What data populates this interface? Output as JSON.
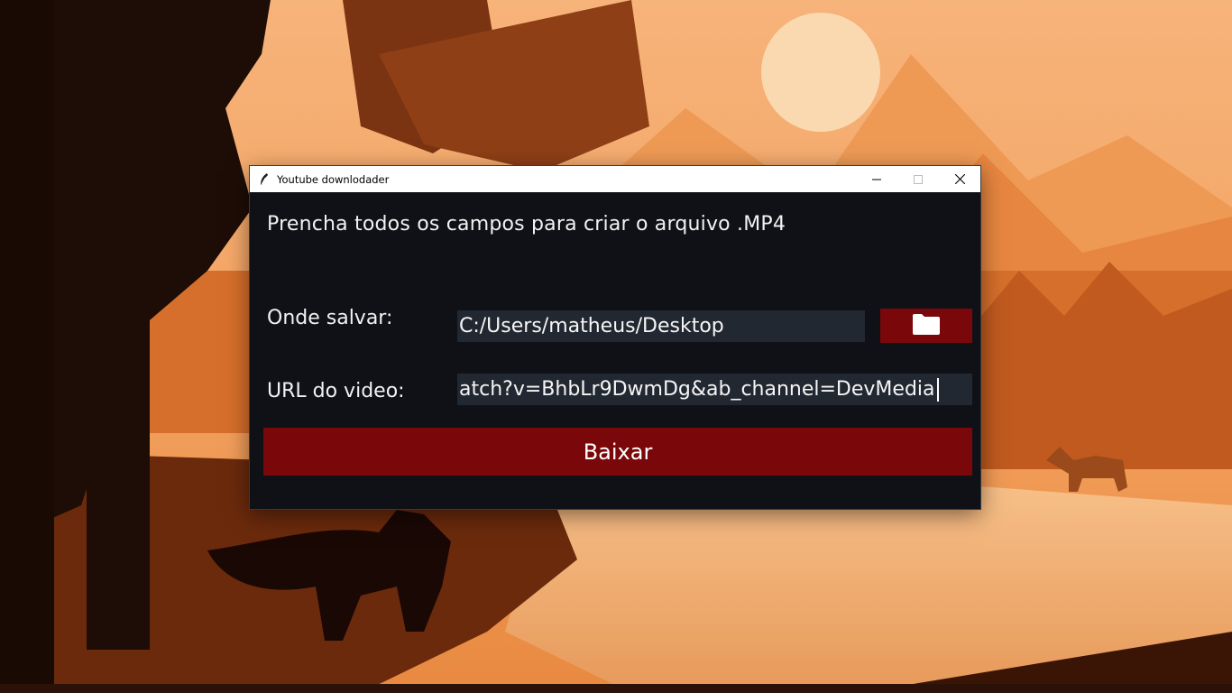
{
  "window": {
    "title": "Youtube downlodader",
    "controls": {
      "minimize_icon": "minimize-icon",
      "maximize_icon": "maximize-icon",
      "close_icon": "close-icon"
    }
  },
  "form": {
    "heading": "Prencha todos os  campos para criar o arquivo .MP4",
    "save_label": "Onde salvar:",
    "save_path_value": "C:/Users/matheus/Desktop",
    "browse_icon": "folder-icon",
    "url_label": "URL do video:",
    "url_value": "atch?v=BhbLr9DwmDg&ab_channel=DevMedia",
    "download_button": "Baixar"
  },
  "colors": {
    "window_bg": "#0f1117",
    "field_bg": "#222831",
    "accent": "#7a0709",
    "text": "#f2f2f2"
  }
}
